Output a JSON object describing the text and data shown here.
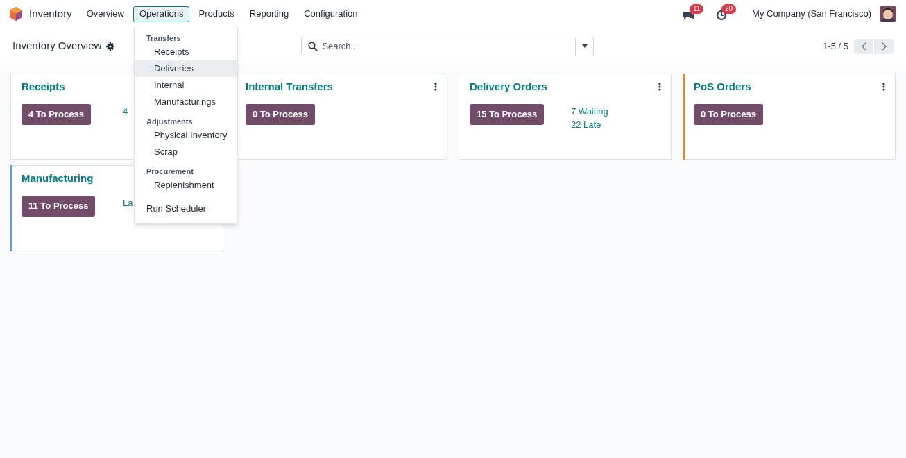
{
  "app": {
    "name": "Inventory"
  },
  "menu": [
    {
      "label": "Overview",
      "selected": false
    },
    {
      "label": "Operations",
      "selected": true
    },
    {
      "label": "Products",
      "selected": false
    },
    {
      "label": "Reporting",
      "selected": false
    },
    {
      "label": "Configuration",
      "selected": false
    }
  ],
  "systray": {
    "messages_count": "11",
    "activities_count": "20",
    "company": "My Company (San Francisco)"
  },
  "breadcrumb": "Inventory Overview",
  "search": {
    "placeholder": "Search..."
  },
  "pager": "1-5 / 5",
  "cards": [
    {
      "title": "Receipts",
      "button": "4 To Process",
      "stats": [
        "4"
      ],
      "kebab": false
    },
    {
      "title": "Internal Transfers",
      "button": "0 To Process",
      "kebab": true
    },
    {
      "title": "Delivery Orders",
      "button": "15 To Process",
      "stats": [
        "7 Waiting",
        "22 Late"
      ],
      "kebab": true
    },
    {
      "title": "PoS Orders",
      "button": "0 To Process",
      "kebab": true,
      "color": "#e8862e"
    },
    {
      "title": "Manufacturing",
      "button": "11 To Process",
      "stats": [
        "La"
      ],
      "kebab": false,
      "color": "#6a9ad8"
    }
  ],
  "dropdown": [
    {
      "kind": "header",
      "label": "Transfers"
    },
    {
      "kind": "item",
      "label": "Receipts",
      "selected": false
    },
    {
      "kind": "item",
      "label": "Deliveries",
      "selected": true
    },
    {
      "kind": "item",
      "label": "Internal",
      "selected": false
    },
    {
      "kind": "item",
      "label": "Manufacturings",
      "selected": false
    },
    {
      "kind": "header",
      "label": "Adjustments"
    },
    {
      "kind": "item",
      "label": "Physical Inventory",
      "selected": false
    },
    {
      "kind": "item",
      "label": "Scrap",
      "selected": false
    },
    {
      "kind": "header",
      "label": "Procurement"
    },
    {
      "kind": "item",
      "label": "Replenishment",
      "selected": false
    },
    {
      "kind": "action",
      "label": "Run Scheduler",
      "selected": false
    }
  ]
}
